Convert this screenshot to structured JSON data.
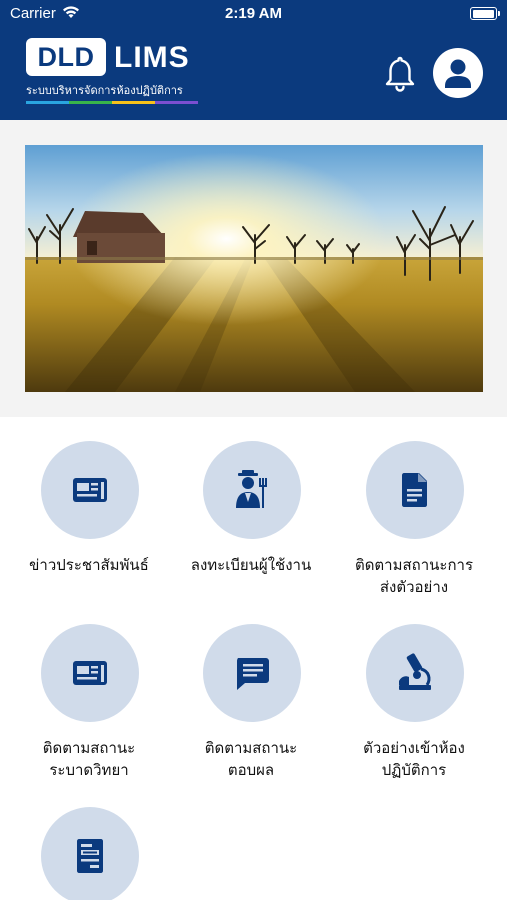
{
  "status_bar": {
    "carrier": "Carrier",
    "time": "2:19 AM",
    "battery_level": 1.0
  },
  "header": {
    "logo_box_text": "DLD",
    "logo_name": "LIMS",
    "logo_subtitle": "ระบบบริหารจัดการห้องปฏิบัติการ",
    "logo_bar_colors": [
      "#2aa5e0",
      "#39b54a",
      "#f7c21b",
      "#7b4fd1"
    ],
    "bell_icon": "bell-icon",
    "profile_icon": "person-icon"
  },
  "banner": {
    "description_icon": "farm-sunrise-photo"
  },
  "menu": [
    {
      "label": "ข่าวประชาสัมพันธ์",
      "icon": "newspaper-icon"
    },
    {
      "label": "ลงทะเบียนผู้ใช้งาน",
      "icon": "farmer-icon"
    },
    {
      "label": "ติดตามสถานะการ\nส่งตัวอย่าง",
      "icon": "document-icon"
    },
    {
      "label": "ติดตามสถานะ\nระบาดวิทยา",
      "icon": "newspaper-icon"
    },
    {
      "label": "ติดตามสถานะ\nตอบผล",
      "icon": "message-icon"
    },
    {
      "label": "ตัวอย่างเข้าห้อง\nปฏิบัติการ",
      "icon": "microscope-icon"
    },
    {
      "label": "",
      "icon": "form-document-icon"
    }
  ],
  "colors": {
    "navy": "#0b3a7e",
    "circle": "#d0dbea"
  }
}
